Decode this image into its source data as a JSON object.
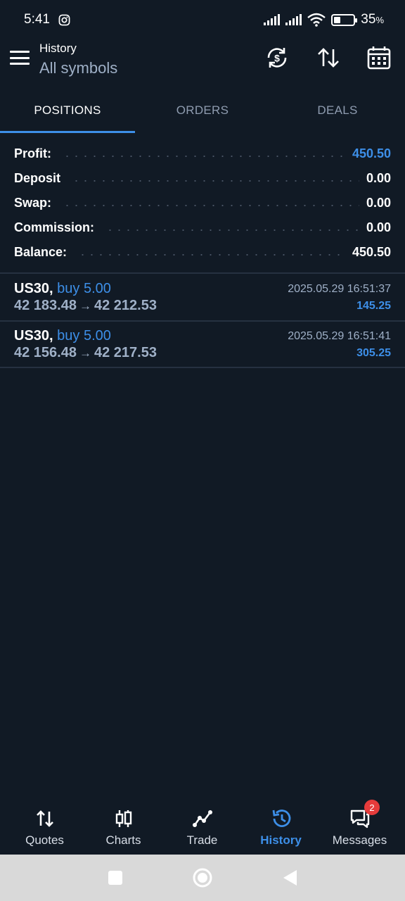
{
  "status_bar": {
    "time": "5:41",
    "battery_pct": "35",
    "battery_unit": "%",
    "battery_level": 0.35
  },
  "app_bar": {
    "title": "History",
    "subtitle": "All symbols"
  },
  "tabs": [
    {
      "label": "POSITIONS",
      "active": true
    },
    {
      "label": "ORDERS",
      "active": false
    },
    {
      "label": "DEALS",
      "active": false
    }
  ],
  "summary": [
    {
      "label": "Profit:",
      "value": "450.50",
      "highlight": true
    },
    {
      "label": "Deposit",
      "value": "0.00",
      "highlight": false
    },
    {
      "label": "Swap:",
      "value": "0.00",
      "highlight": false
    },
    {
      "label": "Commission:",
      "value": "0.00",
      "highlight": false
    },
    {
      "label": "Balance:",
      "value": "450.50",
      "highlight": false
    }
  ],
  "positions": [
    {
      "symbol": "US30,",
      "side": "buy 5.00",
      "open_price": "42 183.48",
      "arrow": "→",
      "close_price": "42 212.53",
      "time": "2025.05.29 16:51:37",
      "profit": "145.25"
    },
    {
      "symbol": "US30,",
      "side": "buy 5.00",
      "open_price": "42 156.48",
      "arrow": "→",
      "close_price": "42 217.53",
      "time": "2025.05.29 16:51:41",
      "profit": "305.25"
    }
  ],
  "bottom_nav": [
    {
      "label": "Quotes",
      "icon": "quotes-icon",
      "active": false
    },
    {
      "label": "Charts",
      "icon": "charts-icon",
      "active": false
    },
    {
      "label": "Trade",
      "icon": "trade-icon",
      "active": false
    },
    {
      "label": "History",
      "icon": "history-icon",
      "active": true
    },
    {
      "label": "Messages",
      "icon": "messages-icon",
      "active": false,
      "badge": "2"
    }
  ],
  "colors": {
    "background": "#111a25",
    "accent": "#3d8fe8",
    "muted": "#9fb0c7",
    "badge": "#e53b3b"
  }
}
